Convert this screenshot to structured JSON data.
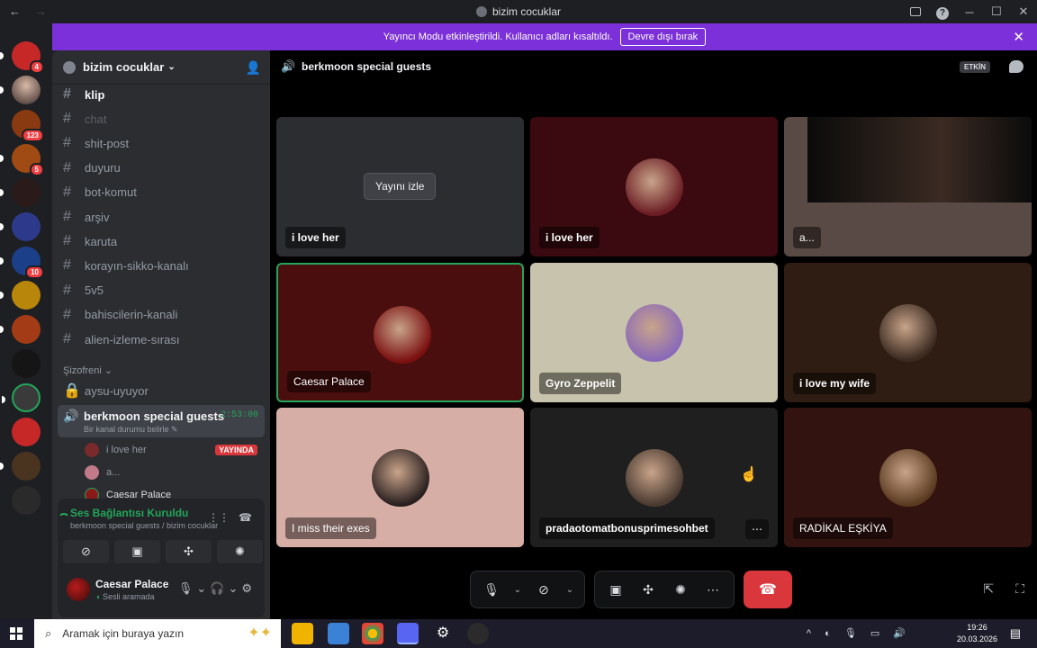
{
  "window": {
    "title": "bizim cocuklar",
    "back": "←",
    "forward": "→"
  },
  "banner": {
    "text": "Yayıncı Modu etkinleştirildi. Kullanıcı adları kısaltıldı.",
    "button": "Devre dışı bırak"
  },
  "server": {
    "name": "bizim cocuklar",
    "rail_badges": [
      "4",
      "123",
      "5",
      "10"
    ]
  },
  "channels": [
    {
      "name": "klip",
      "state": "active"
    },
    {
      "name": "chat",
      "state": "muted"
    },
    {
      "name": "shit-post",
      "state": "normal"
    },
    {
      "name": "duyuru",
      "state": "normal"
    },
    {
      "name": "bot-komut",
      "state": "normal"
    },
    {
      "name": "arşiv",
      "state": "normal"
    },
    {
      "name": "karuta",
      "state": "normal"
    },
    {
      "name": "korayın-sikko-kanalı",
      "state": "normal"
    },
    {
      "name": "5v5",
      "state": "normal"
    },
    {
      "name": "bahiscilerin-kanali",
      "state": "normal"
    },
    {
      "name": "alien-izleme-sırası",
      "state": "normal"
    }
  ],
  "category": {
    "name": "Şizofreni",
    "locked_channel": "aysu-uyuyor"
  },
  "voice_channel": {
    "name": "berkmoon special guests",
    "status": "Bir kanal durumu belirle",
    "timer": "2:53:00",
    "members": [
      {
        "name": "i love her",
        "live": "YAYINDA"
      },
      {
        "name": "a...",
        "live": ""
      },
      {
        "name": "Caesar Palace",
        "live": ""
      }
    ]
  },
  "voice_panel": {
    "status": "Ses Bağlantısı Kuruldu",
    "subtitle": "berkmoon special guests / bizim cocuklar"
  },
  "user": {
    "name": "Caesar Palace",
    "status": "Sesli aramada"
  },
  "main": {
    "channel": "berkmoon special guests",
    "active_badge": "ETKİN",
    "watch_button": "Yayını izle",
    "tiles": [
      {
        "label": "i love her",
        "bg": "#2b2d31"
      },
      {
        "label": "i love her",
        "bg": "#3a0a10"
      },
      {
        "label": "a...",
        "bg": "#5a4a45"
      },
      {
        "label": "Caesar Palace",
        "bg": "#4a0e0e"
      },
      {
        "label": "Gyro Zeppelit",
        "bg": "#c8c3ad"
      },
      {
        "label": "i love my wife",
        "bg": "#2f1c12"
      },
      {
        "label": "I miss their exes",
        "bg": "#d7aea6"
      },
      {
        "label": "pradaotomatbonusprimesohbet",
        "bg": "#1f1f1f"
      },
      {
        "label": "RADİKAL EŞKİYA",
        "bg": "#32130f"
      }
    ]
  },
  "taskbar": {
    "search_placeholder": "Aramak için buraya yazın",
    "time": "19:26",
    "date": "20.03.2026"
  }
}
